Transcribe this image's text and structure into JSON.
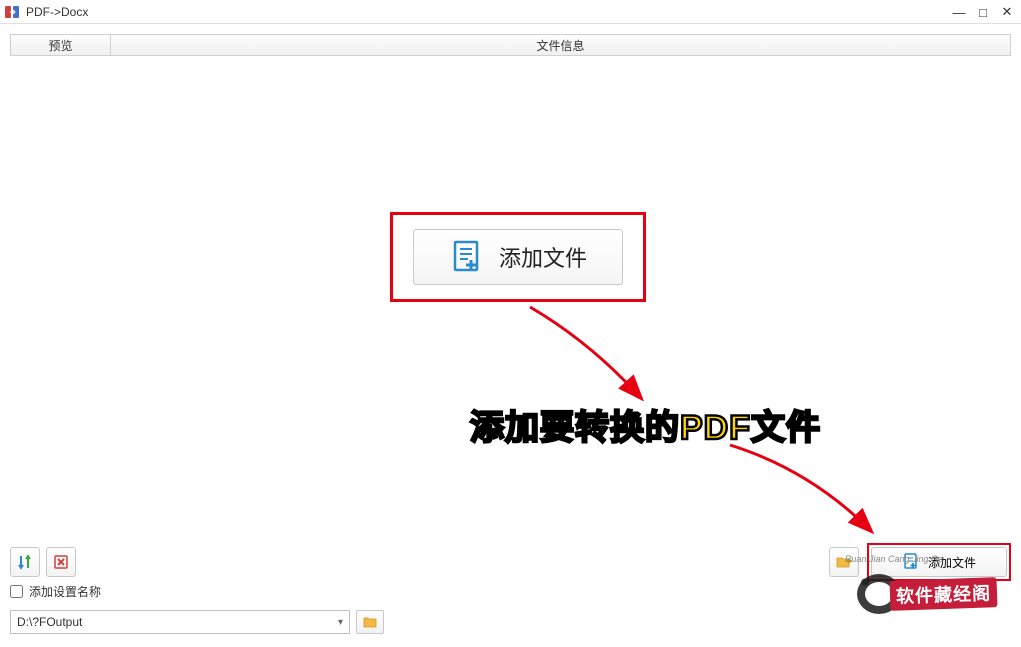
{
  "window": {
    "title": "PDF->Docx"
  },
  "tabs": {
    "preview": "预览",
    "fileinfo": "文件信息"
  },
  "buttons": {
    "add_file_big": "添加文件",
    "add_file_small": "添加文件"
  },
  "annotation": {
    "text": "添加要转换的PDF文件"
  },
  "options": {
    "add_setting_name": "添加设置名称"
  },
  "output": {
    "path": "D:\\?FOutput"
  },
  "watermark": {
    "text": "软件藏经阁"
  }
}
